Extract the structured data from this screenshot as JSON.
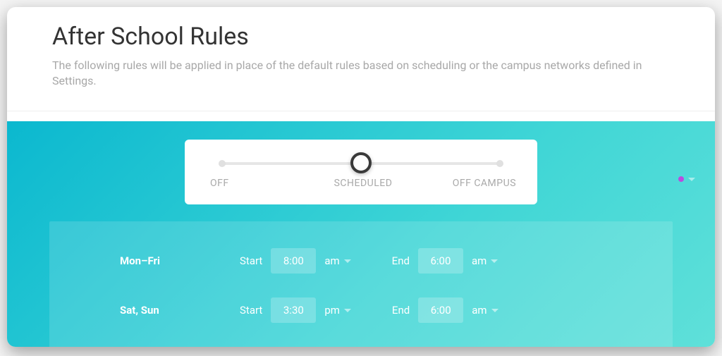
{
  "header": {
    "title": "After School Rules",
    "subtitle": "The following rules will be applied in place of the default rules based on scheduling or the campus networks defined in Settings."
  },
  "mode_slider": {
    "options": [
      "OFF",
      "SCHEDULED",
      "OFF CAMPUS"
    ],
    "selected_index": 1
  },
  "schedule": {
    "rows": [
      {
        "days": "Mon–Fri",
        "start_label": "Start",
        "start_time": "8:00",
        "start_ampm": "am",
        "end_label": "End",
        "end_time": "6:00",
        "end_ampm": "am"
      },
      {
        "days": "Sat, Sun",
        "start_label": "Start",
        "start_time": "3:30",
        "start_ampm": "pm",
        "end_label": "End",
        "end_time": "6:00",
        "end_ampm": "am"
      }
    ]
  },
  "colors": {
    "accent_dot": "#b84de0",
    "gradient_from": "#0bb8cf",
    "gradient_to": "#5fe0d9"
  }
}
